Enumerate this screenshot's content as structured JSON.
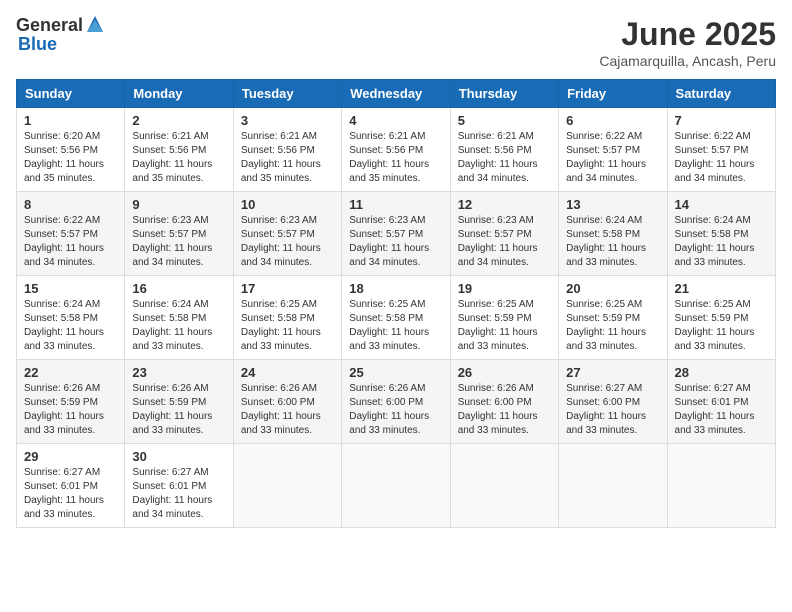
{
  "header": {
    "logo_general": "General",
    "logo_blue": "Blue",
    "month_title": "June 2025",
    "subtitle": "Cajamarquilla, Ancash, Peru"
  },
  "calendar": {
    "days_of_week": [
      "Sunday",
      "Monday",
      "Tuesday",
      "Wednesday",
      "Thursday",
      "Friday",
      "Saturday"
    ],
    "weeks": [
      [
        {
          "day": "1",
          "sunrise": "Sunrise: 6:20 AM",
          "sunset": "Sunset: 5:56 PM",
          "daylight": "Daylight: 11 hours and 35 minutes."
        },
        {
          "day": "2",
          "sunrise": "Sunrise: 6:21 AM",
          "sunset": "Sunset: 5:56 PM",
          "daylight": "Daylight: 11 hours and 35 minutes."
        },
        {
          "day": "3",
          "sunrise": "Sunrise: 6:21 AM",
          "sunset": "Sunset: 5:56 PM",
          "daylight": "Daylight: 11 hours and 35 minutes."
        },
        {
          "day": "4",
          "sunrise": "Sunrise: 6:21 AM",
          "sunset": "Sunset: 5:56 PM",
          "daylight": "Daylight: 11 hours and 35 minutes."
        },
        {
          "day": "5",
          "sunrise": "Sunrise: 6:21 AM",
          "sunset": "Sunset: 5:56 PM",
          "daylight": "Daylight: 11 hours and 34 minutes."
        },
        {
          "day": "6",
          "sunrise": "Sunrise: 6:22 AM",
          "sunset": "Sunset: 5:57 PM",
          "daylight": "Daylight: 11 hours and 34 minutes."
        },
        {
          "day": "7",
          "sunrise": "Sunrise: 6:22 AM",
          "sunset": "Sunset: 5:57 PM",
          "daylight": "Daylight: 11 hours and 34 minutes."
        }
      ],
      [
        {
          "day": "8",
          "sunrise": "Sunrise: 6:22 AM",
          "sunset": "Sunset: 5:57 PM",
          "daylight": "Daylight: 11 hours and 34 minutes."
        },
        {
          "day": "9",
          "sunrise": "Sunrise: 6:23 AM",
          "sunset": "Sunset: 5:57 PM",
          "daylight": "Daylight: 11 hours and 34 minutes."
        },
        {
          "day": "10",
          "sunrise": "Sunrise: 6:23 AM",
          "sunset": "Sunset: 5:57 PM",
          "daylight": "Daylight: 11 hours and 34 minutes."
        },
        {
          "day": "11",
          "sunrise": "Sunrise: 6:23 AM",
          "sunset": "Sunset: 5:57 PM",
          "daylight": "Daylight: 11 hours and 34 minutes."
        },
        {
          "day": "12",
          "sunrise": "Sunrise: 6:23 AM",
          "sunset": "Sunset: 5:57 PM",
          "daylight": "Daylight: 11 hours and 34 minutes."
        },
        {
          "day": "13",
          "sunrise": "Sunrise: 6:24 AM",
          "sunset": "Sunset: 5:58 PM",
          "daylight": "Daylight: 11 hours and 33 minutes."
        },
        {
          "day": "14",
          "sunrise": "Sunrise: 6:24 AM",
          "sunset": "Sunset: 5:58 PM",
          "daylight": "Daylight: 11 hours and 33 minutes."
        }
      ],
      [
        {
          "day": "15",
          "sunrise": "Sunrise: 6:24 AM",
          "sunset": "Sunset: 5:58 PM",
          "daylight": "Daylight: 11 hours and 33 minutes."
        },
        {
          "day": "16",
          "sunrise": "Sunrise: 6:24 AM",
          "sunset": "Sunset: 5:58 PM",
          "daylight": "Daylight: 11 hours and 33 minutes."
        },
        {
          "day": "17",
          "sunrise": "Sunrise: 6:25 AM",
          "sunset": "Sunset: 5:58 PM",
          "daylight": "Daylight: 11 hours and 33 minutes."
        },
        {
          "day": "18",
          "sunrise": "Sunrise: 6:25 AM",
          "sunset": "Sunset: 5:58 PM",
          "daylight": "Daylight: 11 hours and 33 minutes."
        },
        {
          "day": "19",
          "sunrise": "Sunrise: 6:25 AM",
          "sunset": "Sunset: 5:59 PM",
          "daylight": "Daylight: 11 hours and 33 minutes."
        },
        {
          "day": "20",
          "sunrise": "Sunrise: 6:25 AM",
          "sunset": "Sunset: 5:59 PM",
          "daylight": "Daylight: 11 hours and 33 minutes."
        },
        {
          "day": "21",
          "sunrise": "Sunrise: 6:25 AM",
          "sunset": "Sunset: 5:59 PM",
          "daylight": "Daylight: 11 hours and 33 minutes."
        }
      ],
      [
        {
          "day": "22",
          "sunrise": "Sunrise: 6:26 AM",
          "sunset": "Sunset: 5:59 PM",
          "daylight": "Daylight: 11 hours and 33 minutes."
        },
        {
          "day": "23",
          "sunrise": "Sunrise: 6:26 AM",
          "sunset": "Sunset: 5:59 PM",
          "daylight": "Daylight: 11 hours and 33 minutes."
        },
        {
          "day": "24",
          "sunrise": "Sunrise: 6:26 AM",
          "sunset": "Sunset: 6:00 PM",
          "daylight": "Daylight: 11 hours and 33 minutes."
        },
        {
          "day": "25",
          "sunrise": "Sunrise: 6:26 AM",
          "sunset": "Sunset: 6:00 PM",
          "daylight": "Daylight: 11 hours and 33 minutes."
        },
        {
          "day": "26",
          "sunrise": "Sunrise: 6:26 AM",
          "sunset": "Sunset: 6:00 PM",
          "daylight": "Daylight: 11 hours and 33 minutes."
        },
        {
          "day": "27",
          "sunrise": "Sunrise: 6:27 AM",
          "sunset": "Sunset: 6:00 PM",
          "daylight": "Daylight: 11 hours and 33 minutes."
        },
        {
          "day": "28",
          "sunrise": "Sunrise: 6:27 AM",
          "sunset": "Sunset: 6:01 PM",
          "daylight": "Daylight: 11 hours and 33 minutes."
        }
      ],
      [
        {
          "day": "29",
          "sunrise": "Sunrise: 6:27 AM",
          "sunset": "Sunset: 6:01 PM",
          "daylight": "Daylight: 11 hours and 33 minutes."
        },
        {
          "day": "30",
          "sunrise": "Sunrise: 6:27 AM",
          "sunset": "Sunset: 6:01 PM",
          "daylight": "Daylight: 11 hours and 34 minutes."
        },
        null,
        null,
        null,
        null,
        null
      ]
    ]
  }
}
